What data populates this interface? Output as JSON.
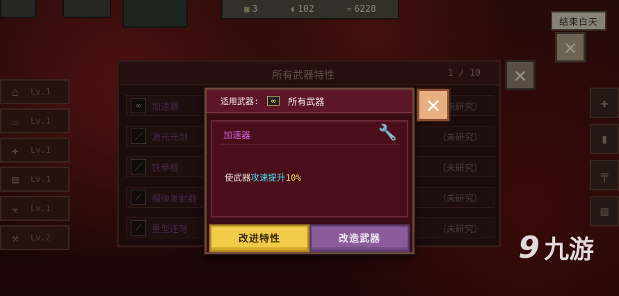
{
  "hud": {
    "days": "3",
    "food": "102",
    "money": "6228",
    "end_day": "结束白天"
  },
  "side_slots": [
    {
      "icon": "⌂",
      "level": "Lv.1"
    },
    {
      "icon": "♨",
      "level": "Lv.1"
    },
    {
      "icon": "✚",
      "level": "Lv.1"
    },
    {
      "icon": "▤",
      "level": "Lv.1"
    },
    {
      "icon": "☣",
      "level": "Lv.1"
    },
    {
      "icon": "⚒",
      "level": "Lv.2"
    }
  ],
  "weapon_list": {
    "title": "所有武器特性",
    "page": "1 / 10",
    "rows": [
      {
        "icon": "∞",
        "name": "加速器",
        "status": "（未研究）"
      },
      {
        "icon": "／",
        "name": "激光光剑",
        "status": "（未研究）"
      },
      {
        "icon": "／",
        "name": "铁拳棍",
        "status": "（未研究）"
      },
      {
        "icon": "⟋",
        "name": "榴弹发射器",
        "status": "（未研究）"
      },
      {
        "icon": "⟋",
        "name": "重型连弩",
        "status": "（未研究）"
      }
    ]
  },
  "modal": {
    "applies_label": "适用武器:",
    "applies_icon": "∞",
    "applies_value": "所有武器",
    "trait_name": "加速器",
    "desc_prefix": "使武器",
    "desc_highlight": "攻速提升",
    "desc_value": "10%",
    "improve_button": "改进特性",
    "modify_button": "改造武器"
  },
  "watermark": {
    "logo": "9",
    "text": "九游"
  },
  "colors": {
    "accent_yellow": "#f2cc48",
    "accent_purple": "#8a5c9a",
    "highlight_cyan": "#50d8f0",
    "trait_magenta": "#d060e0"
  }
}
